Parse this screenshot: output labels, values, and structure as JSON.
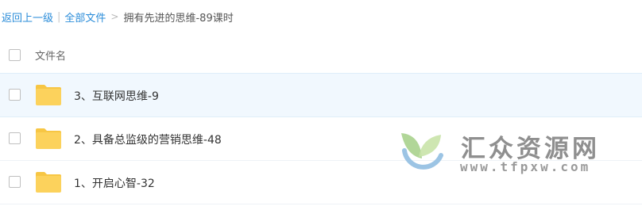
{
  "breadcrumb": {
    "back_label": "返回上一级",
    "separator": "|",
    "all_files_label": "全部文件",
    "arrow": ">",
    "current_label": "拥有先进的思维-89课时"
  },
  "list_header": {
    "name_label": "文件名"
  },
  "rows": [
    {
      "name": "3、互联网思维-9",
      "icon": "folder-icon",
      "selected_highlight": true
    },
    {
      "name": "2、具备总监级的营销思维-48",
      "icon": "folder-icon",
      "selected_highlight": false
    },
    {
      "name": "1、开启心智-32",
      "icon": "folder-icon",
      "selected_highlight": false
    }
  ],
  "watermark": {
    "title": "汇众资源网",
    "url": "www.tfpxw.com"
  },
  "colors": {
    "link": "#2a8cd9",
    "folder": "#fcd25c",
    "folder_tab": "#f7c644",
    "row_highlight": "#f1f8fe"
  }
}
